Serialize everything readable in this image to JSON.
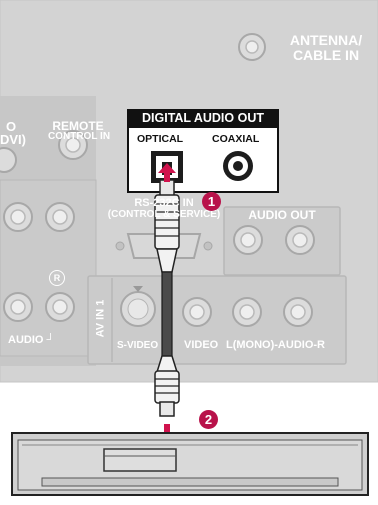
{
  "panel": {
    "antenna_line1": "ANTENNA/",
    "antenna_line2": "CABLE IN",
    "remote_line1": "REMOTE",
    "remote_line2": "CONTROL IN",
    "hdmi_partial_line1": "O",
    "hdmi_partial_line2": "DVI)",
    "rs232_line1": "RS-232C IN",
    "rs232_line2": "(CONTROL & SERVICE)",
    "audio_out": "AUDIO OUT",
    "r_marker": "R",
    "audio_left": "AUDIO",
    "av_in": "AV IN 1",
    "svideo": "S-VIDEO",
    "video": "VIDEO",
    "l_mono": "L(MONO)",
    "audio_r": "-AUDIO-R"
  },
  "digital_audio": {
    "title": "DIGITAL AUDIO OUT",
    "optical": "OPTICAL",
    "coaxial": "COAXIAL"
  },
  "steps": {
    "one": "1",
    "two": "2"
  },
  "colors": {
    "panel": "#d4d4d4",
    "panel_dark": "#b6b6b6",
    "step_badge": "#b8124a",
    "arrow": "#d0134d"
  },
  "icons": {
    "arrow": "arrow-up-icon",
    "arrow_down": "arrow-down-icon"
  }
}
